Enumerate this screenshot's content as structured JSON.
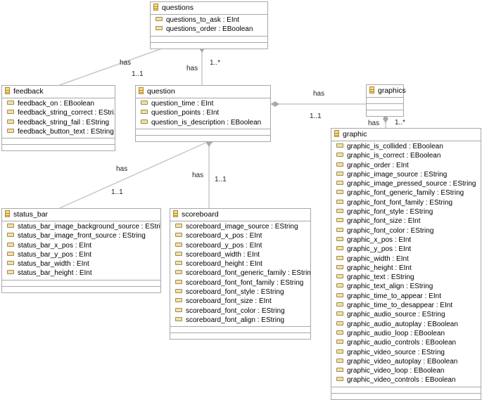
{
  "classes": [
    {
      "id": "questions",
      "name": "questions",
      "attributes": [
        "questions_to_ask : EInt",
        "questions_order : EBoolean"
      ]
    },
    {
      "id": "feedback",
      "name": "feedback",
      "attributes": [
        "feedback_on : EBoolean",
        "feedback_string_correct : EStri...",
        "feedback_string_fail : EString",
        "feedback_button_text : EString"
      ]
    },
    {
      "id": "question",
      "name": "question",
      "attributes": [
        "question_time : EInt",
        "question_points : EInt",
        "question_is_description : EBoolean"
      ]
    },
    {
      "id": "graphics",
      "name": "graphics",
      "attributes": []
    },
    {
      "id": "graphic",
      "name": "graphic",
      "attributes": [
        "graphic_is_collided : EBoolean",
        "graphic_is_correct : EBoolean",
        "graphic_order : EInt",
        "graphic_image_source : EString",
        "graphic_image_pressed_source : EString",
        "graphic_font_generic_family : EString",
        "graphic_font_font_family : EString",
        "graphic_font_style : EString",
        "graphic_font_size : EInt",
        "graphic_font_color : EString",
        "graphic_x_pos : EInt",
        "graphic_y_pos : EInt",
        "graphic_width : EInt",
        "graphic_height : EInt",
        "graphic_text : EString",
        "graphic_text_align : EString",
        "graphic_time_to_appear : EInt",
        "graphic_time_to_desappear : EInt",
        "graphic_audio_source : EString",
        "graphic_audio_autoplay : EBoolean",
        "graphic_audio_loop : EBoolean",
        "graphic_audio_controls : EBoolean",
        "graphic_video_source : EString",
        "graphic_video_autoplay : EBoolean",
        "graphic_video_loop : EBoolean",
        "graphic_video_controls : EBoolean"
      ]
    },
    {
      "id": "status_bar",
      "name": "status_bar",
      "attributes": [
        "status_bar_image_background_source : EString",
        "status_bar_image_front_source : EString",
        "status_bar_x_pos : EInt",
        "status_bar_y_pos : EInt",
        "status_bar_width : EInt",
        "status_bar_height : EInt"
      ]
    },
    {
      "id": "scoreboard",
      "name": "scoreboard",
      "attributes": [
        "scoreboard_image_source : EString",
        "scoreboard_x_pos : EInt",
        "scoreboard_y_pos : EInt",
        "scoreboard_width : EInt",
        "scoreboard_height : EInt",
        "scoreboard_font_generic_family : EString",
        "scoreboard_font_font_family : EString",
        "scoreboard_font_style : EString",
        "scoreboard_font_size : EInt",
        "scoreboard_font_color : EString",
        "scoreboard_font_align : EString"
      ]
    }
  ],
  "relations": [
    {
      "from": "questions",
      "to": "feedback",
      "label": "has",
      "multiplicity": "1..1",
      "kind": "composition"
    },
    {
      "from": "questions",
      "to": "question",
      "label": "has",
      "multiplicity": "1..*",
      "kind": "composition"
    },
    {
      "from": "question",
      "to": "graphics",
      "label": "has",
      "multiplicity": "1..1",
      "kind": "composition"
    },
    {
      "from": "graphics",
      "to": "graphic",
      "label": "has",
      "multiplicity": "1..*",
      "kind": "composition"
    },
    {
      "from": "question",
      "to": "status_bar",
      "label": "has",
      "multiplicity": "1..1",
      "kind": "composition"
    },
    {
      "from": "question",
      "to": "scoreboard",
      "label": "has",
      "multiplicity": "1..1",
      "kind": "composition"
    }
  ],
  "colors": {
    "line": "#c8c8c8",
    "border": "#a8a8a8"
  }
}
